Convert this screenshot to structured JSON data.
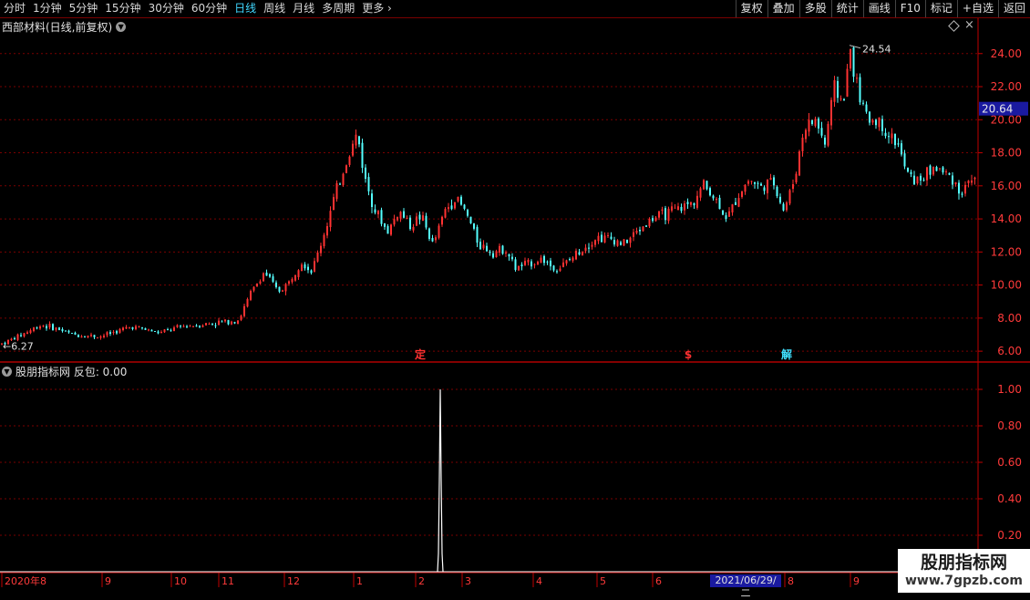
{
  "toolbar": {
    "periods": [
      "分时",
      "1分钟",
      "5分钟",
      "15分钟",
      "30分钟",
      "60分钟",
      "日线",
      "周线",
      "月线",
      "多周期",
      "更多"
    ],
    "active": "日线",
    "buttons": [
      "复权",
      "叠加",
      "多股",
      "统计",
      "画线",
      "F10",
      "标记",
      "+自选",
      "返回"
    ]
  },
  "main": {
    "title": "西部材料(日线,前复权)",
    "high_label": "24.54",
    "low_label": "6.27",
    "current_price": "20.64",
    "markers": [
      {
        "text": "定",
        "color": "#ff3030"
      },
      {
        "text": "$",
        "color": "#ff3030"
      },
      {
        "text": "解",
        "color": "#40e0ff"
      }
    ]
  },
  "indicator": {
    "title": "股朋指标网 反包: 0.00",
    "y_ticks": [
      "1.00",
      "0.80",
      "0.60",
      "0.40",
      "0.20"
    ]
  },
  "x_axis": {
    "labels": [
      "2020年8",
      "9",
      "10",
      "11",
      "12",
      "1",
      "2",
      "3",
      "4",
      "5",
      "6",
      "2021/06/29/二",
      "8",
      "9"
    ]
  },
  "watermark": {
    "line1": "股朋指标网",
    "line2": "www.7gpzb.com"
  },
  "colors": {
    "up": "#ff3232",
    "down": "#54ffff",
    "grid": "#7a0000",
    "axis": "#c00000"
  },
  "chart_data": {
    "type": "candlestick",
    "y_ticks": [
      "24.00",
      "22.00",
      "20.00",
      "18.00",
      "16.00",
      "14.00",
      "12.00",
      "10.00",
      "8.00",
      "6.00"
    ],
    "ylim": [
      5.4,
      25.2
    ],
    "price_path": [
      [
        0,
        6.4
      ],
      [
        20,
        6.9
      ],
      [
        45,
        7.6
      ],
      [
        60,
        7.4
      ],
      [
        80,
        7.0
      ],
      [
        110,
        6.9
      ],
      [
        145,
        7.5
      ],
      [
        175,
        7.1
      ],
      [
        200,
        7.5
      ],
      [
        235,
        7.7
      ],
      [
        262,
        7.9
      ],
      [
        275,
        9.5
      ],
      [
        290,
        10.8
      ],
      [
        305,
        9.6
      ],
      [
        318,
        10.2
      ],
      [
        330,
        11.5
      ],
      [
        342,
        10.8
      ],
      [
        355,
        13.0
      ],
      [
        368,
        15.5
      ],
      [
        380,
        17.5
      ],
      [
        392,
        19.2
      ],
      [
        400,
        16.5
      ],
      [
        412,
        14.5
      ],
      [
        425,
        13.2
      ],
      [
        438,
        14.5
      ],
      [
        450,
        13.6
      ],
      [
        462,
        14.2
      ],
      [
        475,
        12.4
      ],
      [
        488,
        14.5
      ],
      [
        500,
        15.3
      ],
      [
        512,
        14.3
      ],
      [
        525,
        12.5
      ],
      [
        540,
        12.0
      ],
      [
        555,
        12.2
      ],
      [
        565,
        11.0
      ],
      [
        580,
        11.3
      ],
      [
        595,
        11.6
      ],
      [
        610,
        10.9
      ],
      [
        625,
        11.5
      ],
      [
        640,
        12.3
      ],
      [
        655,
        12.9
      ],
      [
        670,
        12.8
      ],
      [
        685,
        12.5
      ],
      [
        700,
        13.3
      ],
      [
        715,
        14.0
      ],
      [
        730,
        14.3
      ],
      [
        745,
        14.6
      ],
      [
        760,
        15.0
      ],
      [
        772,
        16.1
      ],
      [
        785,
        15.2
      ],
      [
        798,
        14.0
      ],
      [
        810,
        15.5
      ],
      [
        822,
        16.4
      ],
      [
        835,
        15.9
      ],
      [
        848,
        16.3
      ],
      [
        860,
        14.5
      ],
      [
        872,
        16.5
      ],
      [
        882,
        19.5
      ],
      [
        895,
        20.0
      ],
      [
        905,
        18.5
      ],
      [
        915,
        22.0
      ],
      [
        925,
        21.0
      ],
      [
        933,
        24.2
      ],
      [
        942,
        21.5
      ],
      [
        952,
        20.0
      ],
      [
        962,
        20.0
      ],
      [
        972,
        19.3
      ],
      [
        985,
        18.5
      ],
      [
        995,
        16.7
      ],
      [
        1005,
        16.3
      ],
      [
        1015,
        16.6
      ],
      [
        1025,
        17.2
      ],
      [
        1035,
        16.8
      ],
      [
        1045,
        16.5
      ],
      [
        1055,
        15.5
      ],
      [
        1065,
        16.5
      ],
      [
        1073,
        16.6
      ]
    ],
    "indicator_spike": {
      "x": 483,
      "value": 1.0
    }
  }
}
